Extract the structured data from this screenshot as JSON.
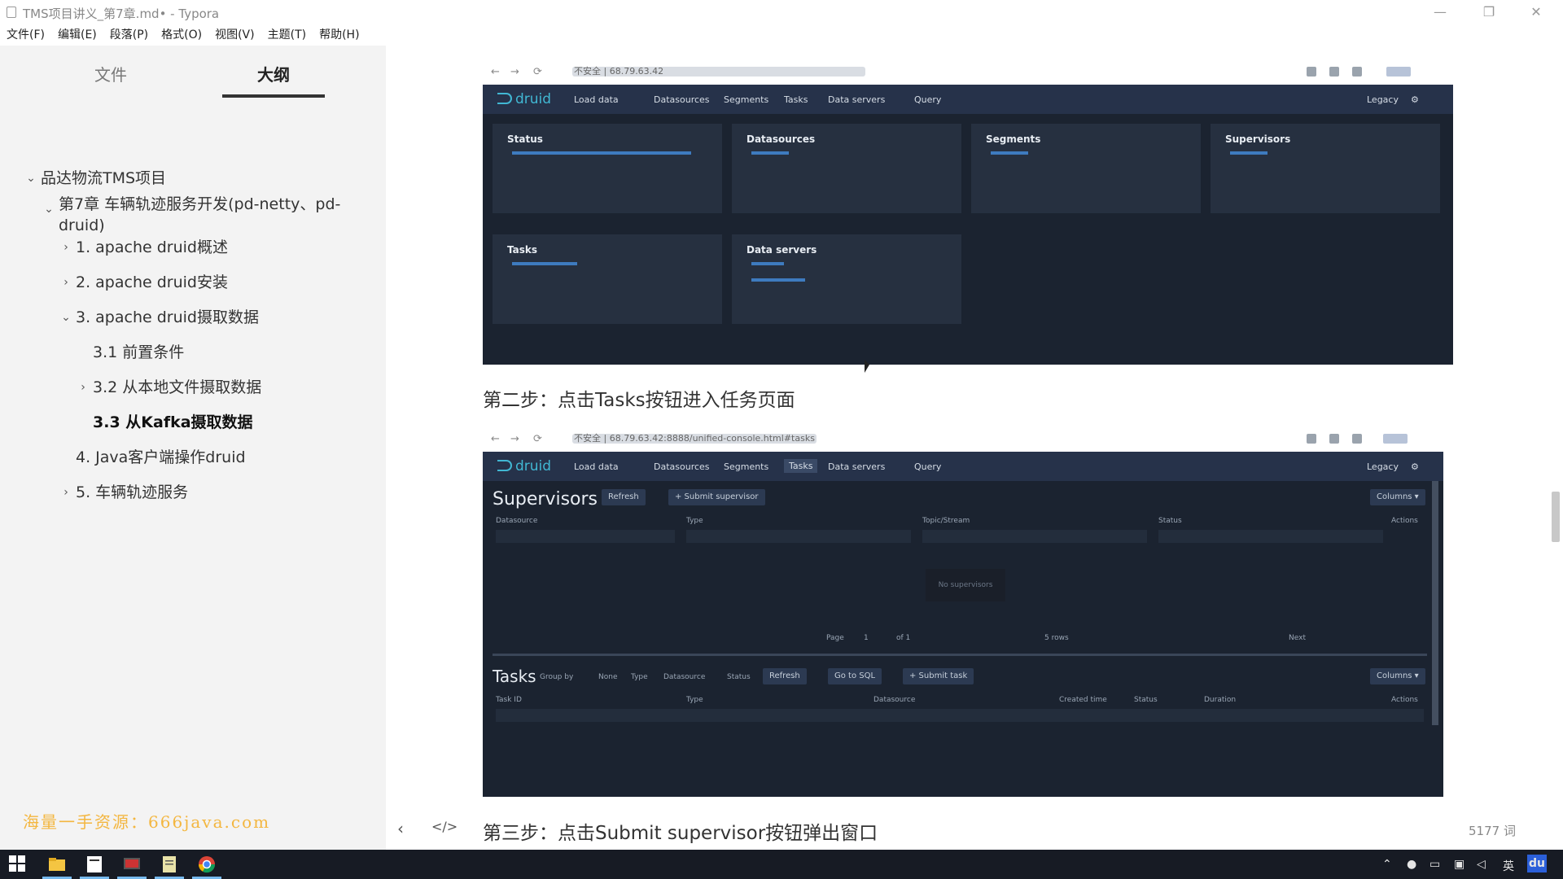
{
  "window": {
    "title": "TMS项目讲义_第7章.md• - Typora"
  },
  "menu": [
    "文件(F)",
    "编辑(E)",
    "段落(P)",
    "格式(O)",
    "视图(V)",
    "主题(T)",
    "帮助(H)"
  ],
  "sidebar": {
    "tab_files": "文件",
    "tab_outline": "大纲",
    "outline": [
      {
        "label": "品达物流TMS项目",
        "chevron": "⌄"
      },
      {
        "label": "第7章 车辆轨迹服务开发(pd-netty、pd-",
        "chevron": "⌄"
      },
      {
        "label": "druid)",
        "chevron": ""
      },
      {
        "label": "1. apache druid概述",
        "chevron": "›"
      },
      {
        "label": "2. apache druid安装",
        "chevron": "›"
      },
      {
        "label": "3. apache druid摄取数据",
        "chevron": "⌄"
      },
      {
        "label": "3.1 前置条件",
        "chevron": ""
      },
      {
        "label": "3.2 从本地文件摄取数据",
        "chevron": "›"
      },
      {
        "label": "3.3 从Kafka摄取数据",
        "chevron": ""
      },
      {
        "label": "4. Java客户端操作druid",
        "chevron": ""
      },
      {
        "label": "5. 车辆轨迹服务",
        "chevron": "›"
      }
    ],
    "watermark": "海量一手资源：666java.com",
    "collapse_icon": "‹",
    "source_icon": "</>"
  },
  "content": {
    "step2": "第二步：点击Tasks按钮进入任务页面",
    "step3": "第三步：点击Submit supervisor按钮弹出窗口",
    "word_count": "5177 词"
  },
  "screenshot1": {
    "url": "不安全 | 68.79.63.42",
    "logo": "druid",
    "nav": [
      "Load data",
      "Datasources",
      "Segments",
      "Tasks",
      "Data servers",
      "Query"
    ],
    "legacy": "Legacy",
    "cards": [
      "Status",
      "Datasources",
      "Segments",
      "Supervisors",
      "Tasks",
      "Data servers"
    ]
  },
  "screenshot2": {
    "url": "不安全 | 68.79.63.42:8888/unified-console.html#tasks",
    "logo": "druid",
    "nav": [
      "Load data",
      "Datasources",
      "Segments",
      "Tasks",
      "Data servers",
      "Query"
    ],
    "legacy": "Legacy",
    "supervisors_title": "Supervisors",
    "refresh": "Refresh",
    "submit_supervisor": "+ Submit supervisor",
    "columns": "Columns ▾",
    "sup_cols": [
      "Datasource",
      "Type",
      "Topic/Stream",
      "Status",
      "Actions"
    ],
    "no_supervisors": "No supervisors",
    "page_label": "Page",
    "page_num": "1",
    "page_of": "of 1",
    "rows": "5 rows",
    "next": "Next",
    "tasks_title": "Tasks",
    "group_by": "Group by",
    "group_opts": [
      "None",
      "Type",
      "Datasource",
      "Status"
    ],
    "retry": "Refresh",
    "go_sql": "Go to SQL",
    "submit_task": "+ Submit task",
    "task_cols": [
      "Task ID",
      "Type",
      "Datasource",
      "Created time",
      "Status",
      "Duration",
      "Actions"
    ]
  },
  "tray": {
    "lang": "英",
    "app": "du"
  }
}
